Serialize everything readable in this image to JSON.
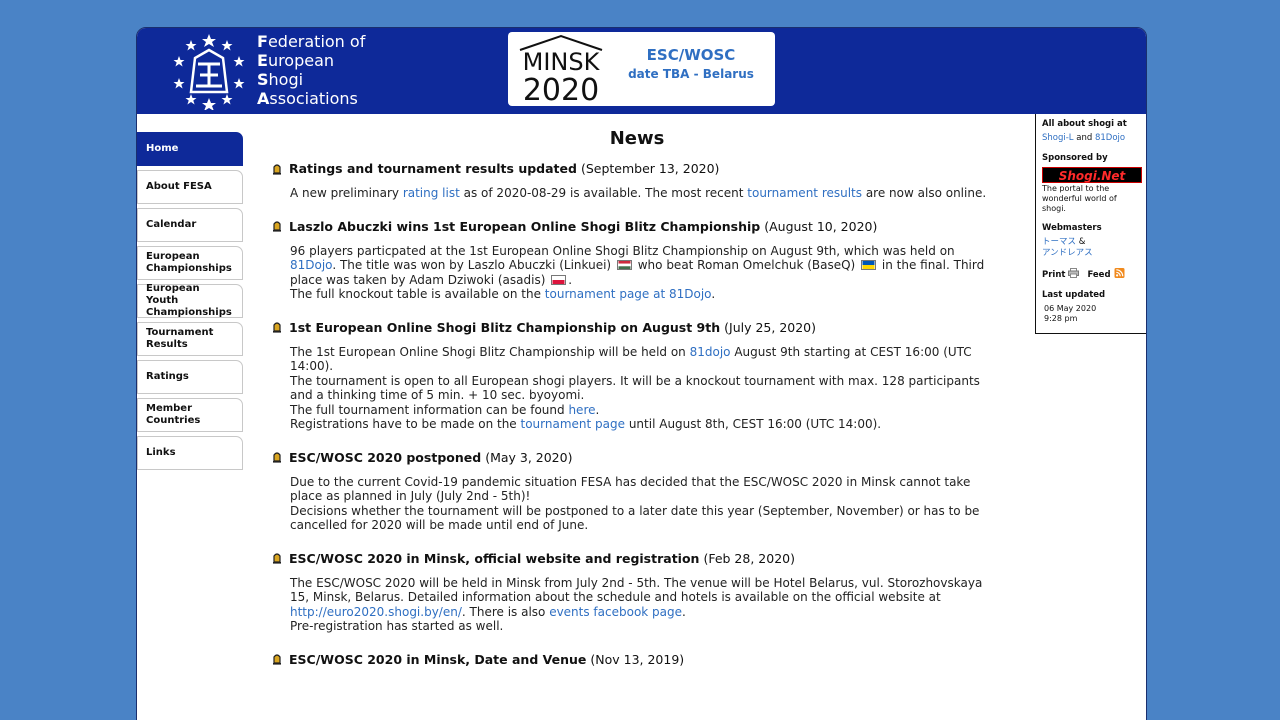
{
  "header": {
    "org_lines": [
      {
        "initial": "F",
        "rest": "ederation of"
      },
      {
        "initial": "E",
        "rest": "uropean"
      },
      {
        "initial": "S",
        "rest": "hogi"
      },
      {
        "initial": "A",
        "rest": "ssociations"
      }
    ],
    "event": {
      "logo_top": "MINSK",
      "logo_bottom": "2020",
      "title": "ESC/WOSC",
      "subtitle": "date TBA  -  Belarus"
    }
  },
  "nav": {
    "items": [
      {
        "label": "Home",
        "active": true
      },
      {
        "label": "About FESA"
      },
      {
        "label": "Calendar"
      },
      {
        "label": "European Championships"
      },
      {
        "label": "European Youth Championships"
      },
      {
        "label": "Tournament Results"
      },
      {
        "label": "Ratings"
      },
      {
        "label": "Member Countries"
      },
      {
        "label": "Links"
      }
    ]
  },
  "main": {
    "title": "News",
    "news": [
      {
        "title": "Ratings and tournament results updated",
        "date": "(September 13, 2020)",
        "p1": {
          "t1": "A new preliminary ",
          "l1": "rating list",
          "t2": " as of 2020-08-29 is available. The most recent ",
          "l2": "tournament results",
          "t3": " are now also online."
        }
      },
      {
        "title": "Laszlo Abuczki wins 1st European Online Shogi Blitz Championship",
        "date": "(August 10, 2020)",
        "p1": {
          "t1": "96 players particpated at the 1st European Online Shogi Blitz Championship on August 9th, which was held on ",
          "l1": "81Dojo",
          "t2": ". The title was won by Laszlo Abuczki (Linkuei) ",
          "t3": " who beat Roman Omelchuk (BaseQ) ",
          "t4": " in the final. Third place was taken by Adam Dziwoki (asadis) ",
          "t5": "."
        },
        "p2": {
          "t1": "The full knockout table is available on the ",
          "l1": "tournament page at 81Dojo",
          "t2": "."
        }
      },
      {
        "title": "1st European Online Shogi Blitz Championship on August 9th",
        "date": "(July 25, 2020)",
        "p1": {
          "t1": "The 1st European Online Shogi Blitz Championship will be held on ",
          "l1": "81dojo",
          "t2": " August 9th starting at CEST 16:00 (UTC 14:00)."
        },
        "p2": "The tournament is open to all European shogi players. It will be a knockout tournament with max. 128 participants and a thinking time of 5 min. + 10 sec. byoyomi.",
        "p3": {
          "t1": "The full tournament information can be found ",
          "l1": "here",
          "t2": "."
        },
        "p4": {
          "t1": "Registrations have to be made on the ",
          "l1": "tournament page",
          "t2": " until August 8th, CEST 16:00 (UTC 14:00)."
        }
      },
      {
        "title": "ESC/WOSC 2020 postponed",
        "date": "(May 3, 2020)",
        "p1": "Due to the current Covid-19 pandemic situation FESA has decided that the ESC/WOSC 2020 in Minsk cannot take place as planned in July (July 2nd - 5th)!",
        "p2": "Decisions whether the tournament will be postponed to a later date this year (September, November) or has to be cancelled for 2020 will be made until end of June."
      },
      {
        "title": "ESC/WOSC 2020 in Minsk, official website and registration",
        "date": "(Feb 28, 2020)",
        "p1": {
          "t1": "The ESC/WOSC 2020 will be held in Minsk from July 2nd - 5th. The venue will be Hotel Belarus, vul. Storozhovskaya 15, Minsk, Belarus. Detailed information about the schedule and hotels is available on the official website at ",
          "l1": "http://euro2020.shogi.by/en/",
          "t2": ". There is also ",
          "l2": "events facebook page",
          "t3": "."
        },
        "p2": "Pre-registration has started as well."
      },
      {
        "title": "ESC/WOSC 2020 in Minsk, Date and Venue",
        "date": "(Nov 13, 2019)"
      }
    ]
  },
  "sidebar": {
    "about_heading": "All about shogi at",
    "about_link1": "Shogi-L",
    "about_and": " and ",
    "about_link2": "81Dojo",
    "sponsor_heading": "Sponsored by",
    "sponsor_logo": "Shogi.Net",
    "sponsor_text": "The portal to the wonderful world of shogi.",
    "webmasters_heading": "Webmasters",
    "webmaster1": "トーマス",
    "webmaster1_suffix": " &",
    "webmaster2": "アンドレアス",
    "print_label": "Print",
    "feed_label": "Feed",
    "updated_heading": "Last updated",
    "updated_date": "06 May 2020",
    "updated_time": "9:28 pm"
  },
  "colors": {
    "page_background": "#4a83c6",
    "header_background": "#0e2999",
    "link": "#2f6fc2",
    "active_nav": "#0e2999"
  }
}
